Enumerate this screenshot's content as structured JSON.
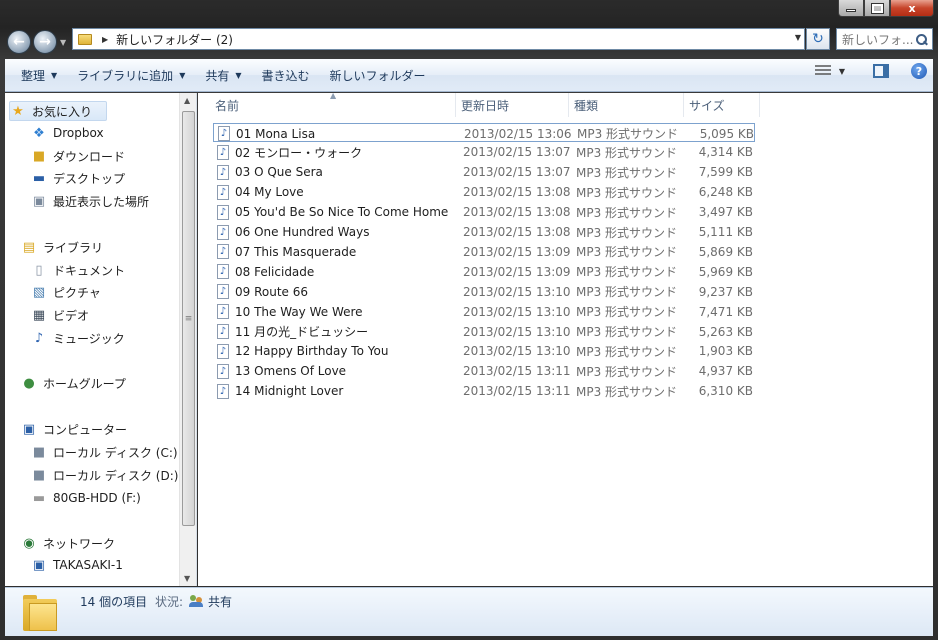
{
  "window": {
    "caption_buttons": {
      "minimize": "",
      "maximize": "",
      "close": "x"
    }
  },
  "address": {
    "path": "新しいフォルダー (2)",
    "search_placeholder": "新しいフォ..."
  },
  "toolbar": {
    "organize": "整理",
    "include_library": "ライブラリに追加",
    "share": "共有",
    "burn": "書き込む",
    "new_folder": "新しいフォルダー"
  },
  "navpane": {
    "favorites": {
      "title": "お気に入り",
      "items": [
        "Dropbox",
        "ダウンロード",
        "デスクトップ",
        "最近表示した場所"
      ]
    },
    "libraries": {
      "title": "ライブラリ",
      "items": [
        "ドキュメント",
        "ピクチャ",
        "ビデオ",
        "ミュージック"
      ]
    },
    "homegroup": "ホームグループ",
    "computer": {
      "title": "コンピューター",
      "items": [
        "ローカル ディスク (C:)",
        "ローカル ディスク (D:)",
        "80GB-HDD (F:)"
      ]
    },
    "network": {
      "title": "ネットワーク",
      "items": [
        "TAKASAKI-1"
      ]
    }
  },
  "columns": {
    "name": "名前",
    "date": "更新日時",
    "type": "種類",
    "size": "サイズ"
  },
  "files": [
    {
      "name": "01 Mona Lisa",
      "date": "2013/02/15 13:06",
      "type": "MP3 形式サウンド",
      "size": "5,095 KB"
    },
    {
      "name": "02 モンロー・ウォーク",
      "date": "2013/02/15 13:07",
      "type": "MP3 形式サウンド",
      "size": "4,314 KB"
    },
    {
      "name": "03 O Que Sera",
      "date": "2013/02/15 13:07",
      "type": "MP3 形式サウンド",
      "size": "7,599 KB"
    },
    {
      "name": "04 My Love",
      "date": "2013/02/15 13:08",
      "type": "MP3 形式サウンド",
      "size": "6,248 KB"
    },
    {
      "name": "05 You'd Be So Nice To Come Home...",
      "date": "2013/02/15 13:08",
      "type": "MP3 形式サウンド",
      "size": "3,497 KB"
    },
    {
      "name": "06 One Hundred Ways",
      "date": "2013/02/15 13:08",
      "type": "MP3 形式サウンド",
      "size": "5,111 KB"
    },
    {
      "name": "07 This Masquerade",
      "date": "2013/02/15 13:09",
      "type": "MP3 形式サウンド",
      "size": "5,869 KB"
    },
    {
      "name": "08 Felicidade",
      "date": "2013/02/15 13:09",
      "type": "MP3 形式サウンド",
      "size": "5,969 KB"
    },
    {
      "name": "09 Route 66",
      "date": "2013/02/15 13:10",
      "type": "MP3 形式サウンド",
      "size": "9,237 KB"
    },
    {
      "name": "10 The Way We Were",
      "date": "2013/02/15 13:10",
      "type": "MP3 形式サウンド",
      "size": "7,471 KB"
    },
    {
      "name": "11 月の光_ドビュッシー",
      "date": "2013/02/15 13:10",
      "type": "MP3 形式サウンド",
      "size": "5,263 KB"
    },
    {
      "name": "12 Happy Birthday To You",
      "date": "2013/02/15 13:10",
      "type": "MP3 形式サウンド",
      "size": "1,903 KB"
    },
    {
      "name": "13 Omens Of Love",
      "date": "2013/02/15 13:11",
      "type": "MP3 形式サウンド",
      "size": "4,937 KB"
    },
    {
      "name": "14 Midnight Lover",
      "date": "2013/02/15 13:11",
      "type": "MP3 形式サウンド",
      "size": "6,310 KB"
    }
  ],
  "status": {
    "count": "14 個の項目",
    "state_label": "状況:",
    "state_value": "共有"
  }
}
